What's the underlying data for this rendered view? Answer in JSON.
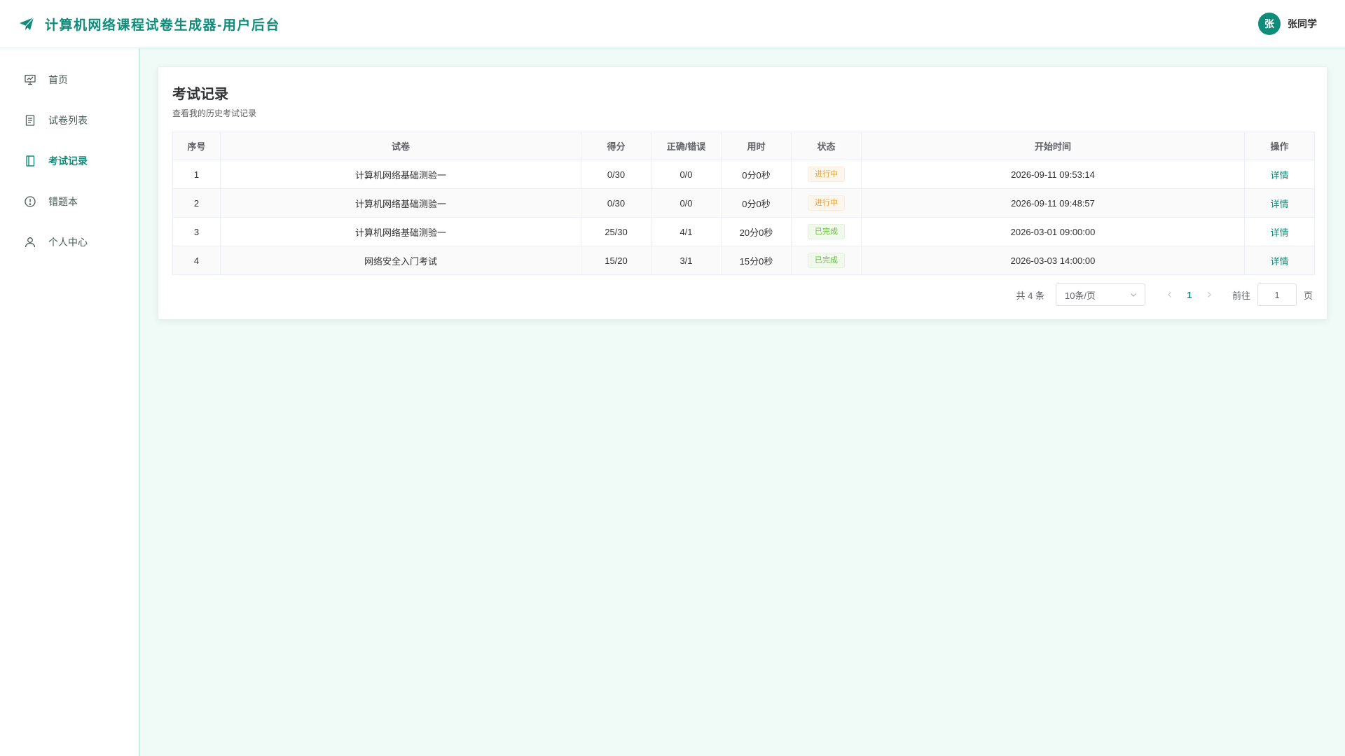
{
  "header": {
    "title": "计算机网络课程试卷生成器-用户后台",
    "brand_icon": "paper-plane-icon",
    "user": {
      "avatar_char": "张",
      "name": "张同学"
    },
    "accent_color": "#0f8c7a"
  },
  "sidebar": {
    "items": [
      {
        "label": "首页",
        "icon": "presentation-icon",
        "active": false
      },
      {
        "label": "试卷列表",
        "icon": "document-icon",
        "active": false
      },
      {
        "label": "考试记录",
        "icon": "notebook-icon",
        "active": true
      },
      {
        "label": "错题本",
        "icon": "alert-circle-icon",
        "active": false
      },
      {
        "label": "个人中心",
        "icon": "user-icon",
        "active": false
      }
    ]
  },
  "main": {
    "title": "考试记录",
    "subtitle": "查看我的历史考试记录",
    "table": {
      "columns": [
        "序号",
        "试卷",
        "得分",
        "正确/错误",
        "用时",
        "状态",
        "开始时间",
        "操作"
      ],
      "rows": [
        {
          "index": "1",
          "paper": "计算机网络基础测验一",
          "score": "0/30",
          "correct_wrong": "0/0",
          "duration": "0分0秒",
          "status": "进行中",
          "status_type": "progress",
          "start_time": "2026-09-11 09:53:14",
          "action": "详情"
        },
        {
          "index": "2",
          "paper": "计算机网络基础测验一",
          "score": "0/30",
          "correct_wrong": "0/0",
          "duration": "0分0秒",
          "status": "进行中",
          "status_type": "progress",
          "start_time": "2026-09-11 09:48:57",
          "action": "详情"
        },
        {
          "index": "3",
          "paper": "计算机网络基础测验一",
          "score": "25/30",
          "correct_wrong": "4/1",
          "duration": "20分0秒",
          "status": "已完成",
          "status_type": "done",
          "start_time": "2026-03-01 09:00:00",
          "action": "详情"
        },
        {
          "index": "4",
          "paper": "网络安全入门考试",
          "score": "15/20",
          "correct_wrong": "3/1",
          "duration": "15分0秒",
          "status": "已完成",
          "status_type": "done",
          "start_time": "2026-03-03 14:00:00",
          "action": "详情"
        }
      ]
    },
    "pagination": {
      "total_text": "共 4 条",
      "page_size": "10条/页",
      "current_page": "1",
      "goto_prefix": "前往",
      "goto_value": "1",
      "goto_suffix": "页"
    }
  }
}
